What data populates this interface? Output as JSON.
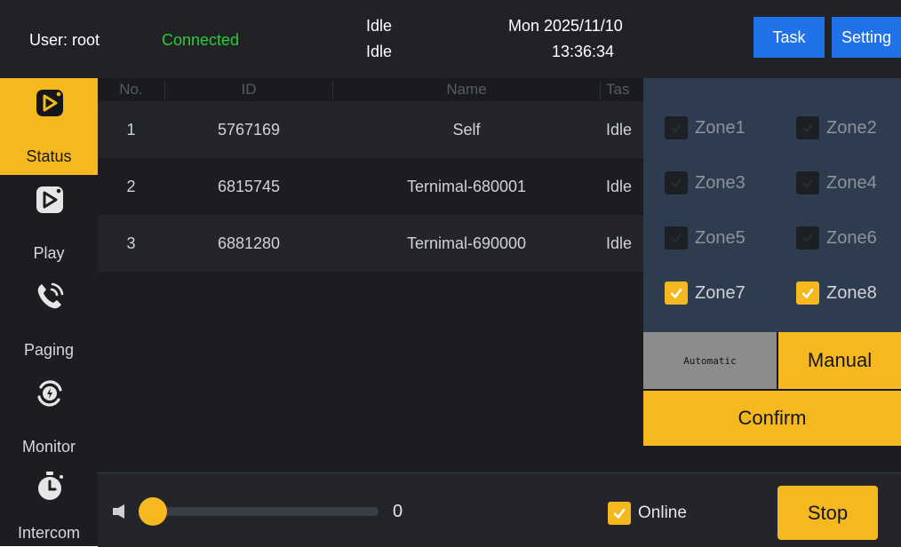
{
  "header": {
    "user_label": "User: root",
    "connection_status": "Connected",
    "state_line1": "Idle",
    "state_line2": "Idle",
    "date": "Mon 2025/11/10",
    "time": "13:36:34",
    "task_button": "Task",
    "setting_button": "Setting"
  },
  "sidebar": {
    "items": [
      {
        "label": "Status",
        "icon": "play-box-icon",
        "active": true
      },
      {
        "label": "Play",
        "icon": "play-box-icon"
      },
      {
        "label": "Paging",
        "icon": "phone-icon"
      },
      {
        "label": "Monitor",
        "icon": "monitor-icon"
      },
      {
        "label": "Intercom",
        "icon": "timer-icon"
      }
    ]
  },
  "table": {
    "headers": [
      "No.",
      "ID",
      "Name",
      "Tas"
    ],
    "rows": [
      {
        "no": "1",
        "id": "5767169",
        "name": "Self",
        "task": "Idle"
      },
      {
        "no": "2",
        "id": "6815745",
        "name": "Ternimal-680001",
        "task": "Idle"
      },
      {
        "no": "3",
        "id": "6881280",
        "name": "Ternimal-690000",
        "task": "Idle"
      }
    ]
  },
  "zones": {
    "items": [
      {
        "label": "Zone1",
        "checked": false
      },
      {
        "label": "Zone2",
        "checked": false
      },
      {
        "label": "Zone3",
        "checked": false
      },
      {
        "label": "Zone4",
        "checked": false
      },
      {
        "label": "Zone5",
        "checked": false
      },
      {
        "label": "Zone6",
        "checked": false
      },
      {
        "label": "Zone7",
        "checked": true
      },
      {
        "label": "Zone8",
        "checked": true
      }
    ],
    "automatic_button": "Automatic",
    "manual_button": "Manual",
    "confirm_button": "Confirm"
  },
  "bottom": {
    "volume_value": "0",
    "volume_level": 0,
    "online_label": "Online",
    "online_checked": true,
    "stop_button": "Stop"
  },
  "colors": {
    "accent": "#f6b81f",
    "connected": "#2ec93c",
    "header_button": "#2172e8",
    "panel": "#2e3c50"
  }
}
